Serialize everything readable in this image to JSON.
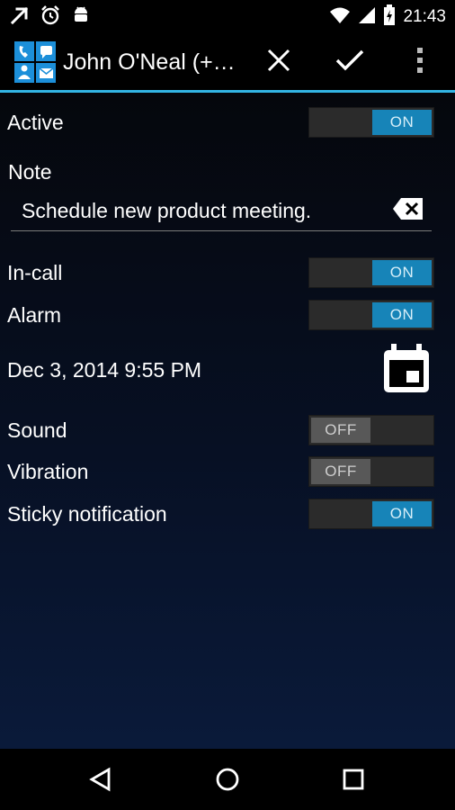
{
  "status_bar": {
    "left_icons": [
      "trending-arrow-icon",
      "alarm-clock-icon",
      "android-icon"
    ],
    "right_icons": [
      "wifi-icon",
      "cell-signal-icon",
      "battery-charging-icon"
    ],
    "time": "21:43"
  },
  "action_bar": {
    "app_icon": "contacts-app-icon",
    "title": "John O'Neal (+…",
    "actions": [
      "close-icon",
      "check-icon",
      "overflow-menu-icon"
    ],
    "accent_color": "#33b5e5"
  },
  "settings": {
    "active": {
      "label": "Active",
      "state": "ON"
    },
    "note": {
      "label": "Note",
      "value": "Schedule new product meeting."
    },
    "in_call": {
      "label": "In-call",
      "state": "ON"
    },
    "alarm": {
      "label": "Alarm",
      "state": "ON"
    },
    "datetime": {
      "value": "Dec 3, 2014 9:55 PM",
      "icon": "calendar-icon"
    },
    "sound": {
      "label": "Sound",
      "state": "OFF"
    },
    "vibration": {
      "label": "Vibration",
      "state": "OFF"
    },
    "sticky": {
      "label": "Sticky notification",
      "state": "ON"
    }
  },
  "colors": {
    "toggle_on": "#1784b8",
    "toggle_off": "#585858"
  },
  "nav_bar": {
    "buttons": [
      "back-icon",
      "home-icon",
      "recents-icon"
    ]
  }
}
